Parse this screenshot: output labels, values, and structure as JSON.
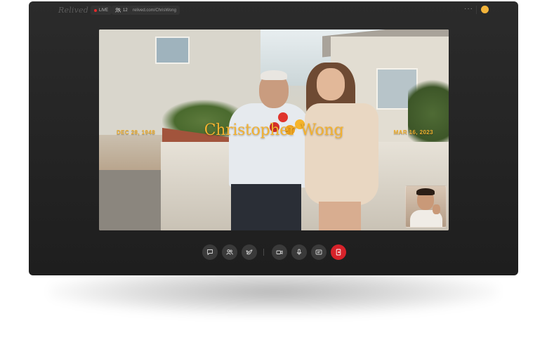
{
  "app": {
    "brand": "Relived"
  },
  "topbar": {
    "live_label": "LIVE",
    "viewer_count": "12",
    "url": "relived.com/ChrisWong",
    "more_label": "···"
  },
  "memorial": {
    "name": "Christopher Wong",
    "birth_date": "DEC 28, 1948",
    "death_date": "MAR 16, 2023"
  },
  "controls": [
    {
      "name": "chat",
      "icon": "chat-icon"
    },
    {
      "name": "participants",
      "icon": "people-icon"
    },
    {
      "name": "reactions",
      "icon": "dove-icon"
    },
    {
      "name": "camera",
      "icon": "camera-icon"
    },
    {
      "name": "microphone",
      "icon": "mic-icon"
    },
    {
      "name": "captions",
      "icon": "captions-icon"
    },
    {
      "name": "leave",
      "icon": "exit-icon"
    }
  ],
  "colors": {
    "accent_gold": "#f3b12f",
    "live_red": "#e32b2b",
    "end_call_red": "#d6222a",
    "window_bg": "#242424"
  }
}
